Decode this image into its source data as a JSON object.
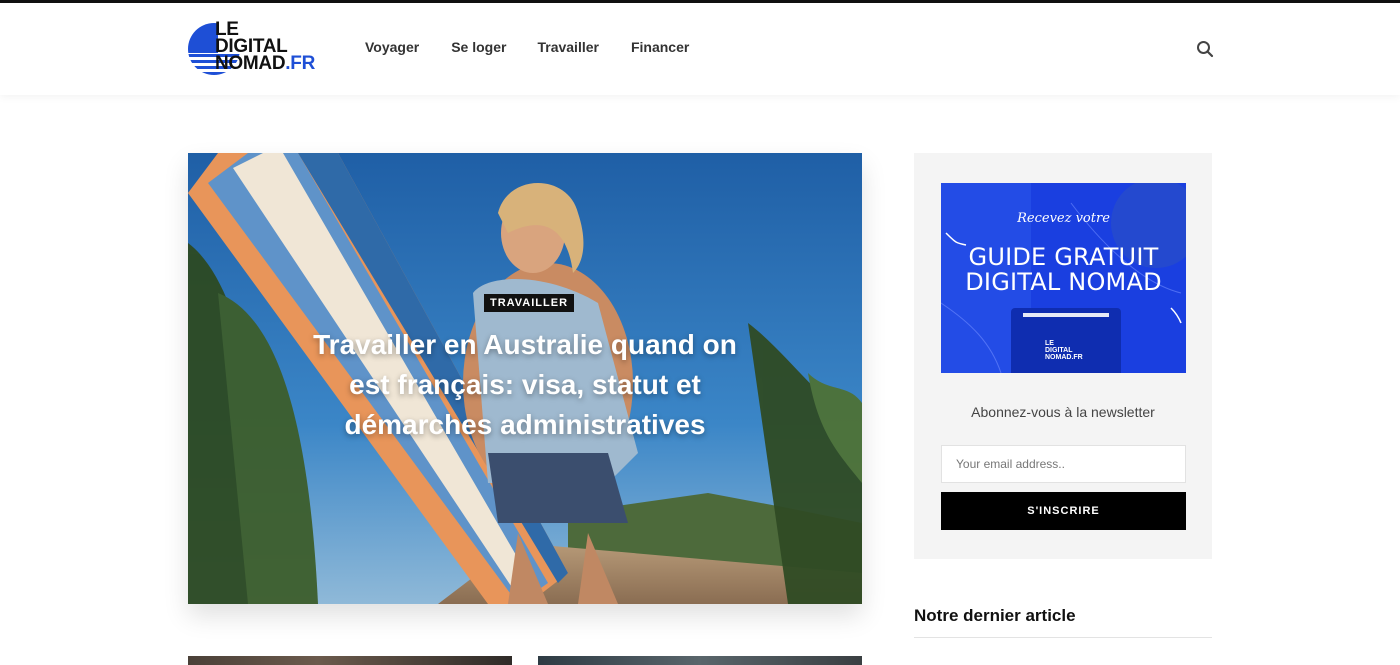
{
  "brand": {
    "logo_lines": [
      "LE",
      "DIGITAL",
      "NOMAD.FR"
    ],
    "accent_color": "#1e4fd6"
  },
  "nav": {
    "items": [
      {
        "label": "Voyager"
      },
      {
        "label": "Se loger"
      },
      {
        "label": "Travailler"
      },
      {
        "label": "Financer"
      }
    ],
    "search_icon": "search-icon"
  },
  "hero": {
    "category": "TRAVAILLER",
    "title": "Travailler en Australie quand on est français: visa, statut et démarches administratives"
  },
  "sidebar": {
    "promo": {
      "kicker": "Recevez votre",
      "title_line1": "GUIDE GRATUIT",
      "title_line2": "DIGITAL NOMAD",
      "logo_lines": [
        "LE",
        "DIGITAL",
        "NOMAD.FR"
      ]
    },
    "newsletter": {
      "label": "Abonnez-vous à la newsletter",
      "email_placeholder": "Your email address..",
      "button_label": "S'INSCRIRE"
    },
    "latest_heading": "Notre dernier article"
  }
}
